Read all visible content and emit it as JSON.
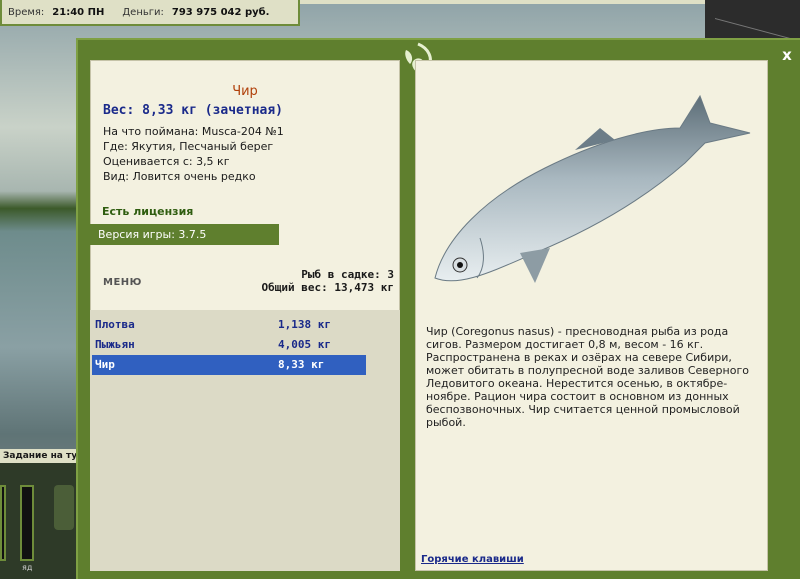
{
  "topbar": {
    "time_label": "Время:",
    "time_value": "21:40 ПН",
    "money_label": "Деньги:",
    "money_value": "793 975 042 руб."
  },
  "task_label": "Задание на тур",
  "gauge_label": "яд",
  "fish": {
    "name": "Чир",
    "weight": "Вес: 8,33 кг (зачетная)",
    "caught_on": "На что поймана: Musca-204 №1",
    "location": "Где: Якутия, Песчаный берег",
    "counted_from": "Оценивается с: 3,5 кг",
    "kind": "Вид: Ловится очень редко",
    "description": "Чир (Coregonus nasus) - пресноводная рыба из рода сигов. Размером достигает 0,8 м, весом - 16 кг. Распространена в реках и озёрах на севере Сибири, может обитать в полупресной воде заливов Северного Ледовитого океана. Нерестится осенью, в октябре-ноябре. Рацион чира состоит в основном из донных беспозвоночных. Чир считается ценной промысловой рыбой."
  },
  "license": "Есть лицензия",
  "version": "Версия игры: 3.7.5",
  "menu_label": "МЕНЮ",
  "cage": {
    "count": "Рыб в садке: 3",
    "total": "Общий вес: 13,473 кг"
  },
  "catch_list": [
    {
      "name": "Плотва",
      "weight": "1,138 кг"
    },
    {
      "name": "Пыжьян",
      "weight": "4,005 кг"
    },
    {
      "name": "Чир",
      "weight": "8,33 кг"
    }
  ],
  "hotkeys_label": "Горячие клавиши",
  "close_label": "x",
  "colors": {
    "frame_green": "#5f7f2e",
    "panel_bg": "#f3f1e0",
    "selection_blue": "#3060c0",
    "title_orange": "#b0400a",
    "text_blue": "#1a2a8a"
  }
}
